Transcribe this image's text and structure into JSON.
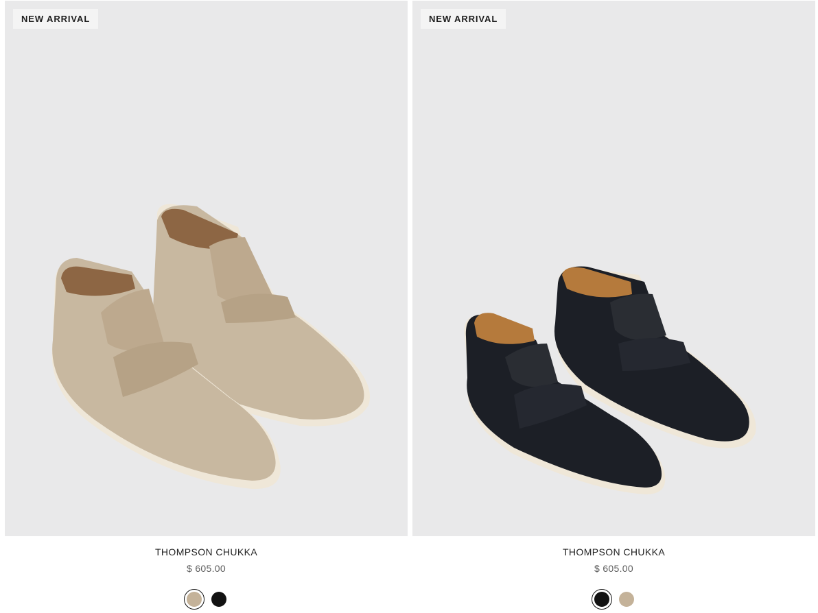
{
  "products": [
    {
      "badge": "NEW ARRIVAL",
      "title": "THOMPSON CHUKKA",
      "price": "$ 605.00",
      "image_alt": "Thompson Chukka in taupe suede",
      "shoe_color": "#c8b8a0",
      "swatches": [
        {
          "name": "Taupe Suede",
          "color": "#c4b299",
          "selected": true
        },
        {
          "name": "Black Suede",
          "color": "#121212",
          "selected": false
        }
      ]
    },
    {
      "badge": "NEW ARRIVAL",
      "title": "THOMPSON CHUKKA",
      "price": "$ 605.00",
      "image_alt": "Thompson Chukka in black suede",
      "shoe_color": "#1c1f26",
      "swatches": [
        {
          "name": "Black Suede",
          "color": "#121212",
          "selected": true
        },
        {
          "name": "Taupe Suede",
          "color": "#c4b299",
          "selected": false
        }
      ]
    }
  ],
  "colors": {
    "image_background": "#e9e9ea",
    "sole": "#efe7d8",
    "lining_light": "#8d6644",
    "lining_dark": "#b57a3c"
  }
}
